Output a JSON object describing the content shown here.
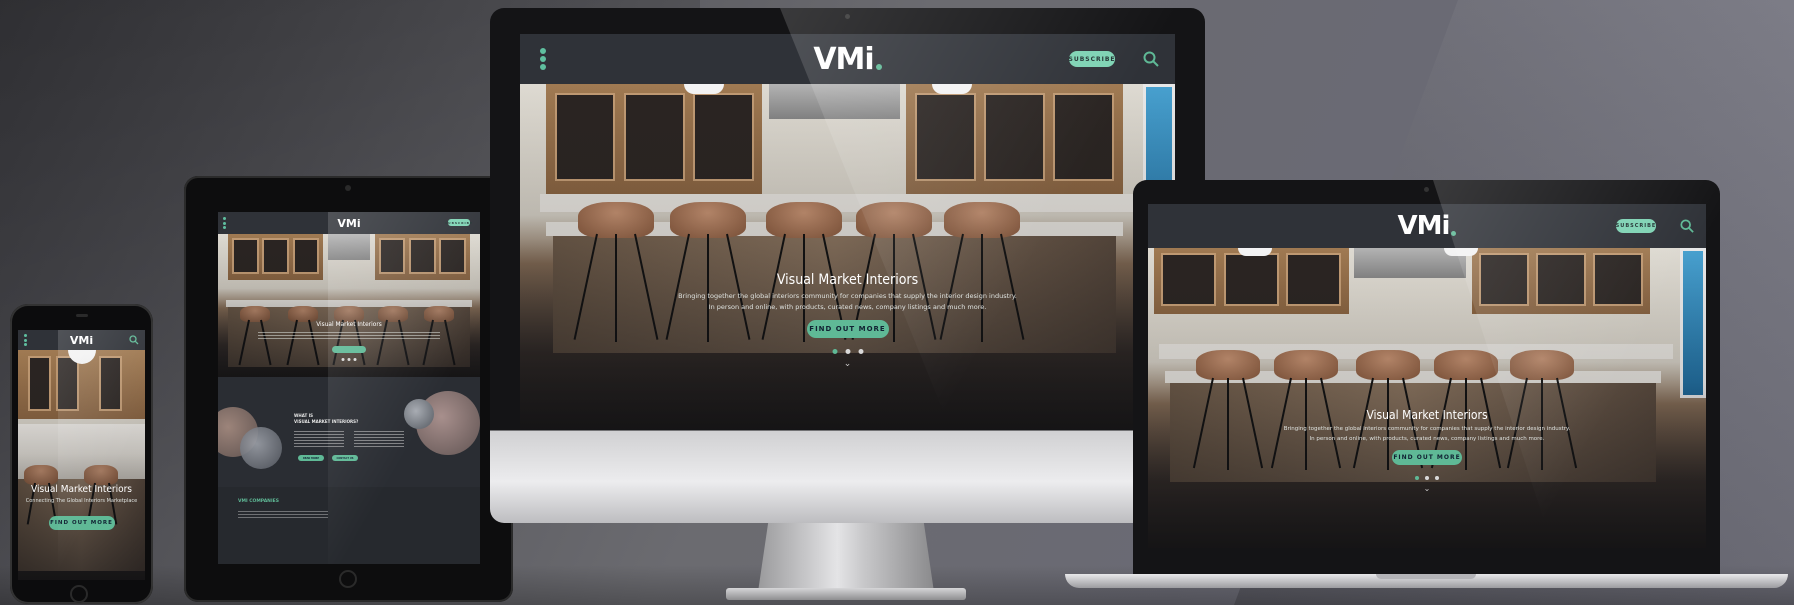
{
  "brand": {
    "logo_text": "VMi",
    "accent": "#5fb996",
    "header_bg": "#2f3238"
  },
  "header": {
    "subscribe_label": "SUBSCRIBE",
    "menu_icon": "kebab-menu-icon",
    "search_icon": "search-icon"
  },
  "hero": {
    "title": "Visual Market Interiors",
    "subtitle_line1": "Bringing together the global interiors community for companies that supply the interior design industry.",
    "subtitle_line2": "In person and online, with products, curated news, company listings and much more.",
    "cta_label": "FIND OUT MORE",
    "slides": 3,
    "active_slide": 1
  },
  "phone": {
    "hero_title": "Visual Market Interiors",
    "hero_subtitle": "Connecting The Global Interiors Marketplace",
    "cta_label": "FIND OUT MORE"
  },
  "tablet": {
    "hero_title": "Visual Market Interiors",
    "about_heading_line1": "WHAT IS",
    "about_heading_line2": "VISUAL MARKET INTERIORS?",
    "read_more_label": "READ MORE",
    "contact_label": "CONTACT US",
    "companies_heading": "VMI COMPANIES"
  }
}
